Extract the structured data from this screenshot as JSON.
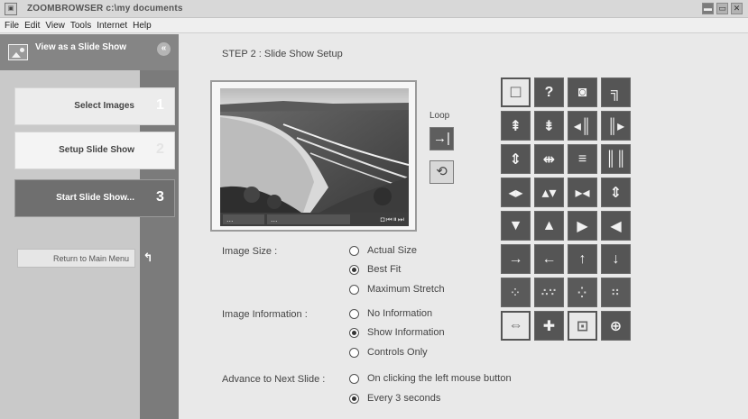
{
  "window": {
    "title": "ZOOMBROWSER c:\\my documents",
    "buttons": [
      "▬",
      "▭",
      "✕"
    ]
  },
  "menu": [
    "File",
    "Edit",
    "View",
    "Tools",
    "Internet",
    "Help"
  ],
  "sidebar": {
    "title": "View as a Slide Show",
    "steps": [
      {
        "label": "Select Images",
        "number": "1"
      },
      {
        "label": "Setup Slide Show",
        "number": "2"
      },
      {
        "label": "Start Slide Show...",
        "number": "3"
      }
    ],
    "return_label": "Return to Main Menu"
  },
  "main": {
    "step_title": "STEP 2 : Slide Show Setup",
    "preview": {
      "info_fields": [
        "...",
        "..."
      ]
    },
    "loop_label": "Loop",
    "image_size": {
      "label": "Image Size :",
      "options": [
        "Actual Size",
        "Best Fit",
        "Maximum Stretch"
      ],
      "selected": "Best Fit"
    },
    "image_information": {
      "label": "Image Information :",
      "options": [
        "No Information",
        "Show Information",
        "Controls Only"
      ],
      "selected": "Show Information"
    },
    "advance": {
      "label": "Advance to Next Slide :",
      "options": [
        "On clicking the left mouse button",
        "Every 3 seconds"
      ],
      "selected": "Every 3 seconds"
    }
  },
  "transitions": [
    {
      "name": "none-icon",
      "glyph": "☐",
      "style": "light"
    },
    {
      "name": "random-icon",
      "glyph": "?",
      "style": "dark"
    },
    {
      "name": "spiral-in-icon",
      "glyph": "◙",
      "style": "dark"
    },
    {
      "name": "spiral-out-icon",
      "glyph": "╗",
      "style": "dark"
    },
    {
      "name": "wipe-up-icon",
      "glyph": "⇞",
      "style": "dark"
    },
    {
      "name": "wipe-down-icon",
      "glyph": "⇟",
      "style": "dark"
    },
    {
      "name": "wipe-left-icon",
      "glyph": "◂║",
      "style": "dark"
    },
    {
      "name": "wipe-right-icon",
      "glyph": "║▸",
      "style": "dark"
    },
    {
      "name": "split-vertical-icon",
      "glyph": "⇕",
      "style": "dark"
    },
    {
      "name": "split-horizontal-icon",
      "glyph": "⇹",
      "style": "dark"
    },
    {
      "name": "blinds-horizontal-icon",
      "glyph": "≡",
      "style": "dark"
    },
    {
      "name": "blinds-vertical-icon",
      "glyph": "║║",
      "style": "dark"
    },
    {
      "name": "push-horizontal-icon",
      "glyph": "◂▸",
      "style": "dark"
    },
    {
      "name": "push-vertical-icon",
      "glyph": "▴▾",
      "style": "dark"
    },
    {
      "name": "pull-horizontal-icon",
      "glyph": "▸◂",
      "style": "dark"
    },
    {
      "name": "pull-vertical-icon",
      "glyph": "⇕",
      "style": "dark"
    },
    {
      "name": "cover-down-icon",
      "glyph": "▼",
      "style": "dark"
    },
    {
      "name": "cover-up-icon",
      "glyph": "▲",
      "style": "dark"
    },
    {
      "name": "cover-right-icon",
      "glyph": "▶",
      "style": "dark"
    },
    {
      "name": "cover-left-icon",
      "glyph": "◀",
      "style": "dark"
    },
    {
      "name": "slide-right-icon",
      "glyph": "→",
      "style": "dark"
    },
    {
      "name": "slide-left-icon",
      "glyph": "←",
      "style": "dark"
    },
    {
      "name": "slide-up-icon",
      "glyph": "↑",
      "style": "dark"
    },
    {
      "name": "slide-down-icon",
      "glyph": "↓",
      "style": "dark"
    },
    {
      "name": "dissolve-fine-icon",
      "glyph": "⁘",
      "style": "dots"
    },
    {
      "name": "dissolve-medium-icon",
      "glyph": "∴∵",
      "style": "dots"
    },
    {
      "name": "dissolve-coarse-icon",
      "glyph": "⁛",
      "style": "dots"
    },
    {
      "name": "dissolve-blocks-icon",
      "glyph": "∷",
      "style": "dots"
    },
    {
      "name": "expand-horizontal-icon",
      "glyph": "⇔",
      "style": "light"
    },
    {
      "name": "expand-center-icon",
      "glyph": "✚",
      "style": "dark"
    },
    {
      "name": "box-in-icon",
      "glyph": "⊡",
      "style": "light"
    },
    {
      "name": "box-out-icon",
      "glyph": "⊕",
      "style": "dark"
    }
  ]
}
